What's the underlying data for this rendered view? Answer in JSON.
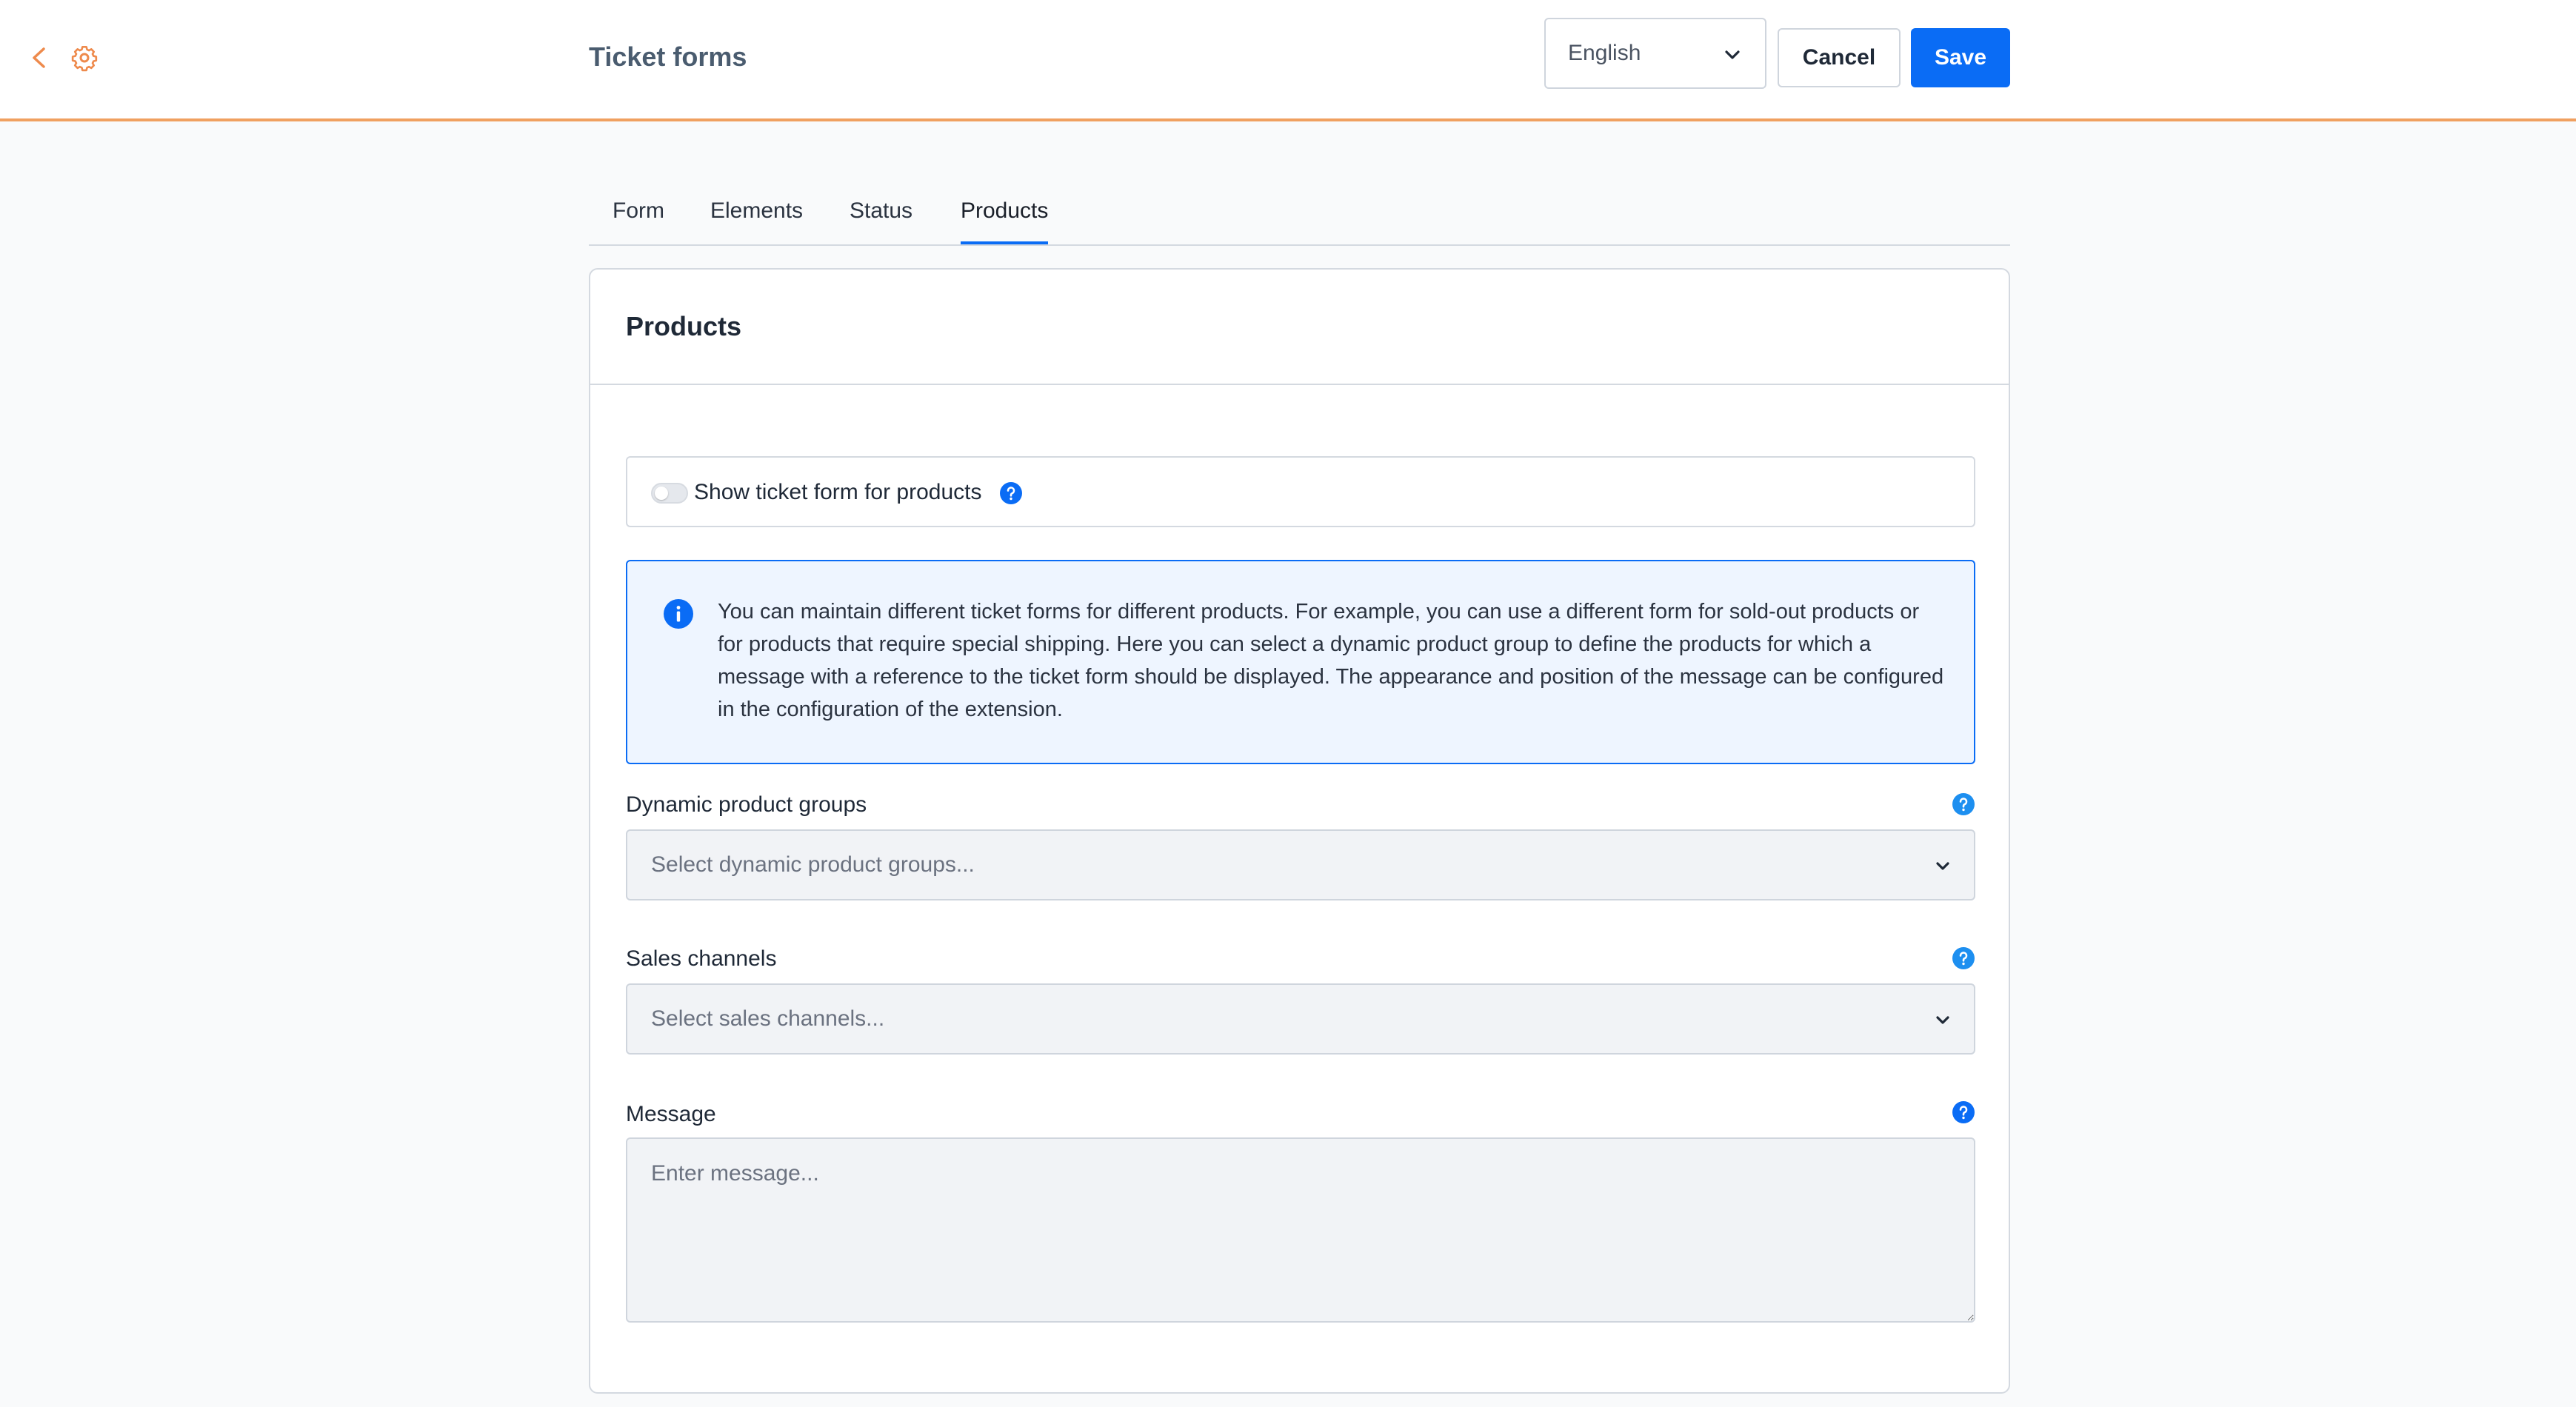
{
  "header": {
    "title": "Ticket forms",
    "language": "English",
    "cancel_label": "Cancel",
    "save_label": "Save"
  },
  "tabs": [
    {
      "label": "Form",
      "active": false
    },
    {
      "label": "Elements",
      "active": false
    },
    {
      "label": "Status",
      "active": false
    },
    {
      "label": "Products",
      "active": true
    }
  ],
  "card": {
    "title": "Products",
    "toggle": {
      "label": "Show ticket form for products",
      "checked": false
    },
    "info": "You can maintain different ticket forms for different products. For example, you can use a different form for sold-out products or for products that require special shipping. Here you can select a dynamic product group to define the products for which a message with a reference to the ticket form should be displayed. The appearance and position of the message can be configured in the configuration of the extension.",
    "dynamic_groups": {
      "label": "Dynamic product groups",
      "placeholder": "Select dynamic product groups..."
    },
    "sales_channels": {
      "label": "Sales channels",
      "placeholder": "Select sales channels..."
    },
    "message": {
      "label": "Message",
      "placeholder": "Enter message..."
    }
  },
  "colors": {
    "accent": "#0a6cf5",
    "header_border": "#f0a060",
    "icon_orange": "#ee8a4c"
  },
  "icons": {
    "back": "chevron-left-icon",
    "settings": "gear-icon",
    "help": "question-circle-icon",
    "info": "info-circle-icon",
    "dropdown": "chevron-down-icon"
  }
}
